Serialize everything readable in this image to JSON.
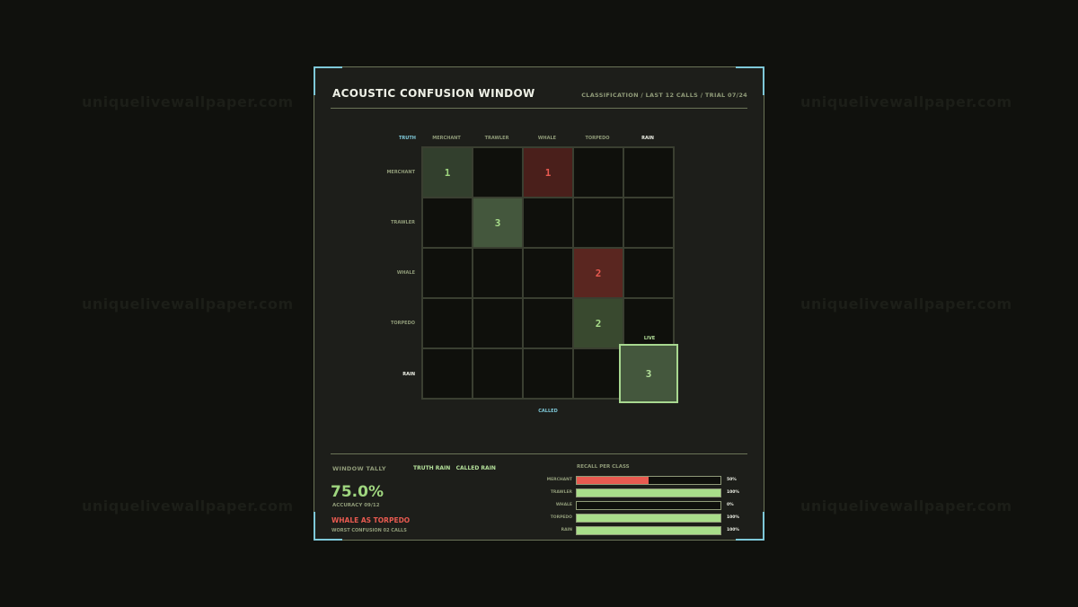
{
  "watermark": "uniquelivewallpaper.com",
  "panel": {
    "title": "ACOUSTIC CONFUSION WINDOW",
    "subtitle": "CLASSIFICATION / LAST 12 CALLS / TRIAL 07/24"
  },
  "matrix": {
    "corner_label": "TRUTH",
    "axis_called_label": "CALLED",
    "live_label": "LIVE",
    "classes": [
      "MERCHANT",
      "TRAWLER",
      "WHALE",
      "TORPEDO",
      "RAIN"
    ],
    "active_class": "RAIN",
    "cells": [
      [
        "1",
        "",
        "1",
        "",
        ""
      ],
      [
        "",
        "3",
        "",
        "",
        ""
      ],
      [
        "",
        "",
        "",
        "2",
        ""
      ],
      [
        "",
        "",
        "",
        "2",
        ""
      ],
      [
        "",
        "",
        "",
        "",
        "3"
      ]
    ]
  },
  "tally": {
    "label": "WINDOW TALLY",
    "truth_called": "TRUTH RAIN   CALLED RAIN",
    "accuracy_pct": "75.0%",
    "accuracy_detail": "ACCURACY 09/12",
    "worst_main": "WHALE AS TORPEDO",
    "worst_detail": "WORST CONFUSION 02 CALLS"
  },
  "recall": {
    "title": "RECALL PER CLASS",
    "rows": [
      {
        "name": "MERCHANT",
        "value": 50,
        "label": "50%",
        "color": "#e85a50"
      },
      {
        "name": "TRAWLER",
        "value": 100,
        "label": "100%",
        "color": "#a9de8a"
      },
      {
        "name": "WHALE",
        "value": 0,
        "label": "0%",
        "color": "#a9de8a"
      },
      {
        "name": "TORPEDO",
        "value": 100,
        "label": "100%",
        "color": "#a9de8a"
      },
      {
        "name": "RAIN",
        "value": 100,
        "label": "100%",
        "color": "#a9de8a"
      }
    ]
  }
}
